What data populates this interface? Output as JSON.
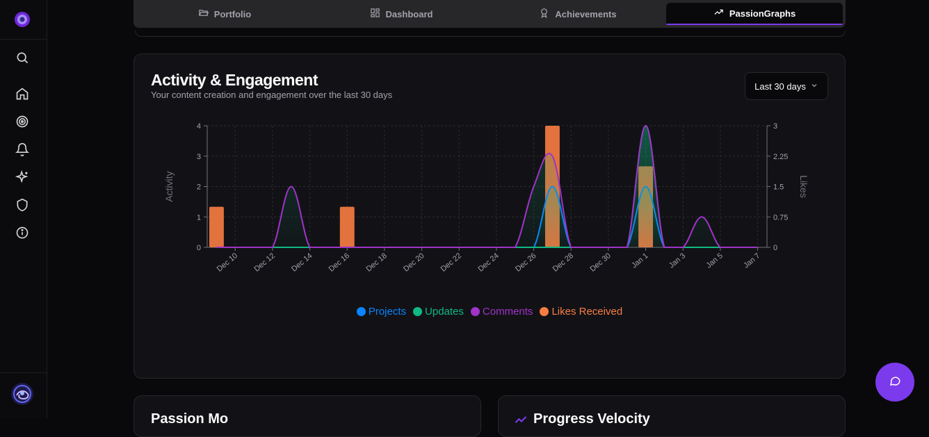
{
  "tabs": [
    {
      "label": "Portfolio",
      "icon": "folder-open-icon",
      "active": false
    },
    {
      "label": "Dashboard",
      "icon": "dashboard-grid-icon",
      "active": false
    },
    {
      "label": "Achievements",
      "icon": "award-icon",
      "active": false
    },
    {
      "label": "PassionGraphs",
      "icon": "trending-up-icon",
      "active": true
    }
  ],
  "sidebar": {
    "items": [
      "search-icon",
      "home-icon",
      "target-icon",
      "bell-icon",
      "sparkles-icon",
      "shield-icon",
      "info-icon"
    ]
  },
  "activity_card": {
    "title": "Activity & Engagement",
    "subtitle": "Your content creation and engagement over the last 30 days",
    "range_label": "Last 30 days"
  },
  "chart_data": {
    "type": "area",
    "x_ticks": [
      "Dec 10",
      "Dec 12",
      "Dec 14",
      "Dec 16",
      "Dec 18",
      "Dec 20",
      "Dec 22",
      "Dec 24",
      "Dec 26",
      "Dec 28",
      "Dec 30",
      "Jan 1",
      "Jan 3",
      "Jan 5",
      "Jan 7"
    ],
    "x": [
      "Dec 9",
      "Dec 10",
      "Dec 11",
      "Dec 12",
      "Dec 13",
      "Dec 14",
      "Dec 15",
      "Dec 16",
      "Dec 17",
      "Dec 18",
      "Dec 19",
      "Dec 20",
      "Dec 21",
      "Dec 22",
      "Dec 23",
      "Dec 24",
      "Dec 25",
      "Dec 26",
      "Dec 27",
      "Dec 28",
      "Dec 29",
      "Dec 30",
      "Dec 31",
      "Jan 1",
      "Jan 2",
      "Jan 3",
      "Jan 4",
      "Jan 5",
      "Jan 6",
      "Jan 7"
    ],
    "left_axis": {
      "label": "Activity",
      "ticks": [
        "0",
        "1",
        "2",
        "3",
        "4"
      ],
      "ylim": [
        0,
        4
      ]
    },
    "right_axis": {
      "label": "Likes",
      "ticks": [
        "0",
        "0.75",
        "1.5",
        "2.25",
        "3"
      ],
      "ylim": [
        0,
        3
      ]
    },
    "grid": true,
    "legend_position": "bottom",
    "series": [
      {
        "name": "Projects",
        "color": "#0a84ff",
        "axis": "left",
        "values": [
          0,
          0,
          0,
          0,
          0,
          0,
          0,
          0,
          0,
          0,
          0,
          0,
          0,
          0,
          0,
          0,
          0,
          0,
          2,
          0,
          0,
          0,
          0,
          2,
          0,
          0,
          0,
          0,
          0,
          0
        ]
      },
      {
        "name": "Updates",
        "color": "#10b981",
        "axis": "left",
        "values": [
          0,
          0,
          0,
          0,
          0,
          0,
          0,
          0,
          0,
          0,
          0,
          0,
          0,
          0,
          0,
          0,
          0,
          0,
          0,
          0,
          0,
          0,
          0,
          4,
          0,
          0,
          0,
          0,
          0,
          0
        ]
      },
      {
        "name": "Comments",
        "color": "#a033c8",
        "axis": "left",
        "values": [
          0,
          0,
          0,
          0,
          2,
          0,
          0,
          0,
          0,
          0,
          0,
          0,
          0,
          0,
          0,
          0,
          0,
          2,
          3,
          0,
          0,
          0,
          0,
          4,
          0,
          0,
          1,
          0,
          0,
          0
        ]
      },
      {
        "name": "Likes Received",
        "color": "#f97d43",
        "axis": "right",
        "type": "bar",
        "values": [
          1,
          0,
          0,
          0,
          0,
          0,
          0,
          1,
          0,
          0,
          0,
          0,
          0,
          0,
          0,
          0,
          0,
          0,
          3,
          0,
          0,
          0,
          0,
          2,
          0,
          0,
          0,
          0,
          0,
          0
        ]
      }
    ]
  },
  "card2": {
    "title": "Passion Mo"
  },
  "card3": {
    "title": "Progress Velocity",
    "icon": "trending-up-icon"
  },
  "fab": {
    "icon": "chat-bubble-icon"
  }
}
